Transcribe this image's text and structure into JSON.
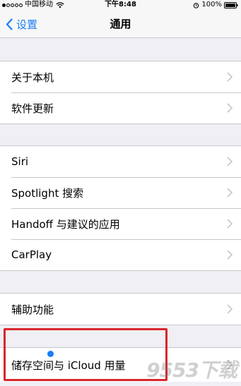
{
  "status_bar": {
    "carrier": "中国移动",
    "time": "下午8:48",
    "battery": "100%"
  },
  "nav": {
    "back_label": "设置",
    "title": "通用"
  },
  "groups": [
    {
      "items": [
        "关于本机",
        "软件更新"
      ]
    },
    {
      "items": [
        "Siri",
        "Spotlight 搜索",
        "Handoff 与建议的应用",
        "CarPlay"
      ]
    },
    {
      "items": [
        "辅助功能"
      ]
    },
    {
      "items": [
        "储存空间与 iCloud 用量"
      ]
    }
  ],
  "watermark": "9553下载",
  "colors": {
    "accent": "#1a7ef5",
    "highlight": "#d9262c",
    "background": "#efeff4"
  }
}
